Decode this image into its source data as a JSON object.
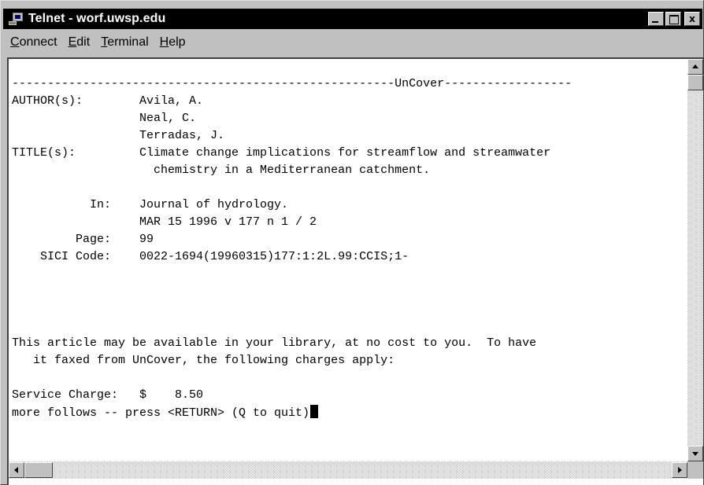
{
  "window": {
    "title": "Telnet - worf.uwsp.edu",
    "icon": "telnet-computer-icon",
    "controls": {
      "minimize": "",
      "maximize": "",
      "close": "x"
    }
  },
  "menu": [
    {
      "prefix": "",
      "key": "C",
      "rest": "onnect"
    },
    {
      "prefix": "",
      "key": "E",
      "rest": "dit"
    },
    {
      "prefix": "",
      "key": "T",
      "rest": "erminal"
    },
    {
      "prefix": "",
      "key": "H",
      "rest": "elp"
    }
  ],
  "terminal": {
    "lines": [
      "------------------------------------------------------UnCover------------------",
      "AUTHOR(s):        Avila, A.",
      "                  Neal, C.",
      "                  Terradas, J.",
      "TITLE(s):         Climate change implications for streamflow and streamwater",
      "                    chemistry in a Mediterranean catchment.",
      "",
      "           In:    Journal of hydrology.",
      "                  MAR 15 1996 v 177 n 1 / 2",
      "         Page:    99",
      "    SICI Code:    0022-1694(19960315)177:1:2L.99:CCIS;1-",
      "",
      "",
      "",
      "",
      "This article may be available in your library, at no cost to you.  To have",
      "   it faxed from UnCover, the following charges apply:",
      "",
      "Service Charge:   $    8.50",
      "more follows -- press <RETURN> (Q to quit)"
    ]
  }
}
